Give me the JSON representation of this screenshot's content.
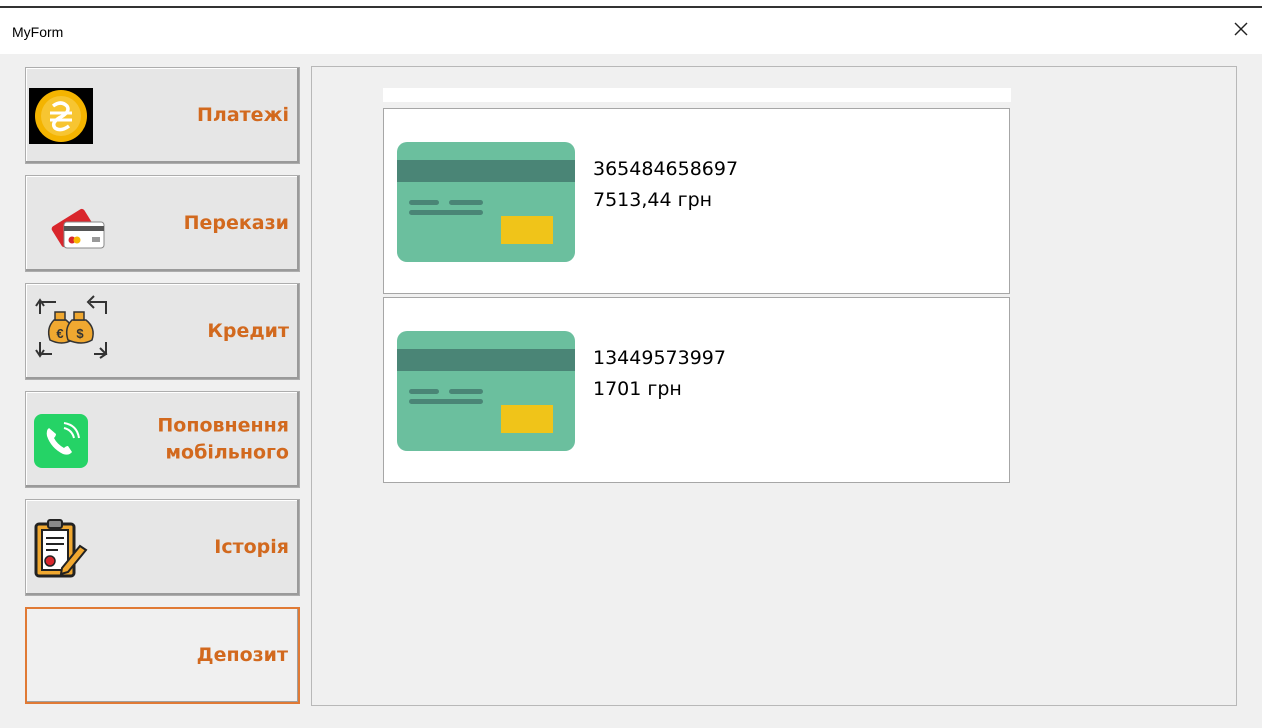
{
  "window": {
    "title": "MyForm"
  },
  "nav": {
    "payments": {
      "label": "Платежі",
      "icon": "hryvnia-coin-icon"
    },
    "transfers": {
      "label": "Перекази",
      "icon": "credit-cards-icon"
    },
    "credit": {
      "label": "Кредит",
      "icon": "money-bags-exchange-icon"
    },
    "mobile_topup": {
      "label_line1": "Поповнення",
      "label_line2": "мобільного",
      "icon": "phone-icon"
    },
    "history": {
      "label": "Історія",
      "icon": "clipboard-report-icon"
    },
    "deposit": {
      "label": "Депозит",
      "active": true
    }
  },
  "cards": [
    {
      "number": "365484658697",
      "balance": "7513,44 грн",
      "icon": "bank-card-icon"
    },
    {
      "number": "13449573997",
      "balance": "1701 грн",
      "icon": "bank-card-icon"
    }
  ],
  "colors": {
    "accent": "#d2691e",
    "card_body": "#6bbf9e",
    "card_stripe": "#4a8576",
    "card_chip": "#f0c419"
  }
}
